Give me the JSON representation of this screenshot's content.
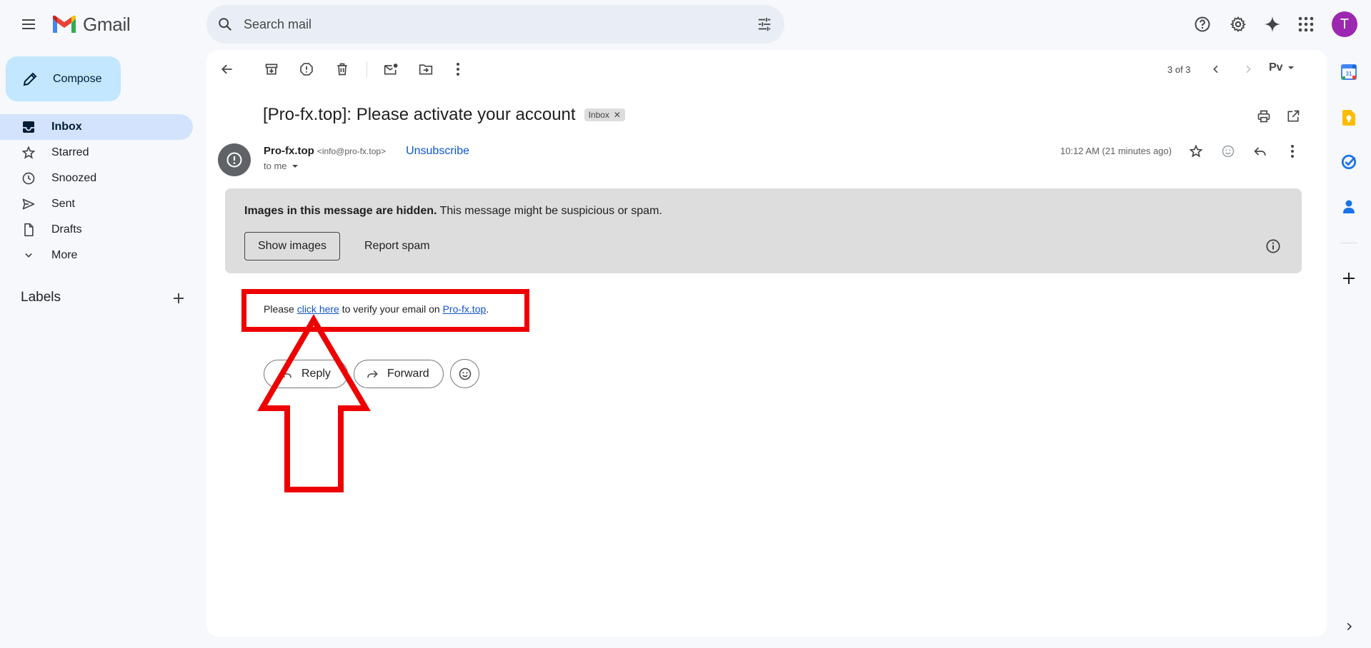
{
  "app": {
    "name": "Gmail"
  },
  "search": {
    "placeholder": "Search mail"
  },
  "account": {
    "initial": "T",
    "avatar_color": "#9c27b0"
  },
  "sidebar": {
    "compose_label": "Compose",
    "items": [
      {
        "label": "Inbox",
        "icon": "inbox-icon",
        "active": true
      },
      {
        "label": "Starred",
        "icon": "star-icon"
      },
      {
        "label": "Snoozed",
        "icon": "clock-icon"
      },
      {
        "label": "Sent",
        "icon": "send-icon"
      },
      {
        "label": "Drafts",
        "icon": "draft-icon"
      },
      {
        "label": "More",
        "icon": "chevron-down-icon"
      }
    ],
    "labels_heading": "Labels"
  },
  "toolbar": {
    "counter": "3 of 3",
    "input_tool": "Pv"
  },
  "email": {
    "subject": "[Pro-fx.top]: Please activate your account",
    "label_chip": "Inbox",
    "sender_name": "Pro-fx.top",
    "sender_email": "<info@pro-fx.top>",
    "unsubscribe": "Unsubscribe",
    "to": "to me",
    "time": "10:12 AM (21 minutes ago)",
    "warning_bold": "Images in this message are hidden.",
    "warning_rest": " This message might be suspicious or spam.",
    "show_images": "Show images",
    "report_spam": "Report spam",
    "body_prefix": "Please ",
    "body_link1": "click here",
    "body_middle": " to verify your email on ",
    "body_link2": "Pro-fx.top",
    "body_suffix": ".",
    "reply": "Reply",
    "forward": "Forward"
  },
  "colors": {
    "accent": "#0b57d0",
    "compose_bg": "#c2e7ff",
    "active_nav": "#d3e3fd",
    "annotation": "#ee0000"
  }
}
